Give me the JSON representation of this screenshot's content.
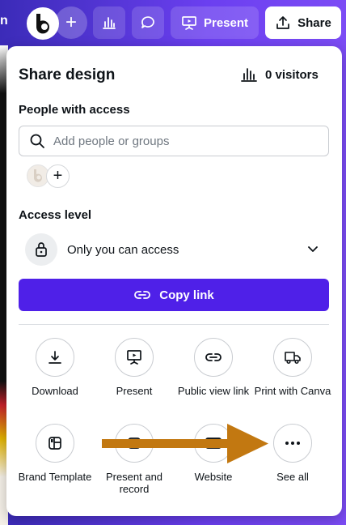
{
  "topbar": {
    "left_text": "n",
    "present_label": "Present",
    "share_label": "Share"
  },
  "panel": {
    "title": "Share design",
    "visitors": "0 visitors",
    "people_label": "People with access",
    "search_placeholder": "Add people or groups",
    "access_label": "Access level",
    "access_value": "Only you can access",
    "copy_link_label": "Copy link"
  },
  "options": [
    {
      "label": "Download",
      "icon": "download-icon"
    },
    {
      "label": "Present",
      "icon": "present-icon"
    },
    {
      "label": "Public view link",
      "icon": "link-icon"
    },
    {
      "label": "Print with Canva",
      "icon": "truck-icon"
    },
    {
      "label": "Brand Template",
      "icon": "template-icon"
    },
    {
      "label": "Present and record",
      "icon": "record-icon"
    },
    {
      "label": "Website",
      "icon": "website-icon"
    },
    {
      "label": "See all",
      "icon": "more-icon"
    }
  ],
  "colors": {
    "accent": "#4f20e8",
    "arrow": "#c27811"
  }
}
